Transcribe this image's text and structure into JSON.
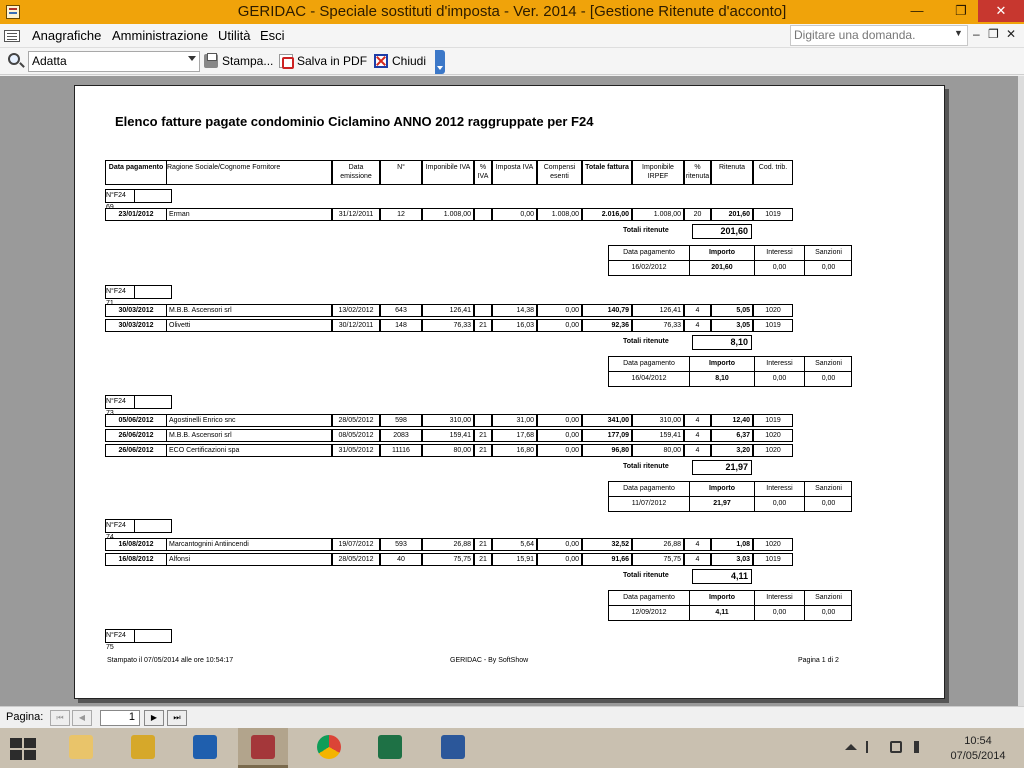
{
  "window": {
    "title": "GERIDAC - Speciale sostituti d'imposta - Ver. 2014 - [Gestione Ritenute d'acconto]",
    "minimize": "—",
    "restore": "❐",
    "close": "✕"
  },
  "menu": {
    "items": [
      "Anagrafiche",
      "Amministrazione",
      "Utilità",
      "Esci"
    ],
    "help_placeholder": "Digitare una domanda.",
    "mdi_min": "‒",
    "mdi_restore": "❐",
    "mdi_close": "✕"
  },
  "toolbar": {
    "zoom_value": "Adatta",
    "print_label": "Stampa...",
    "pdf_label": "Salva in PDF",
    "close_label": "Chiudi"
  },
  "report": {
    "title": "Elenco fatture pagate condominio Ciclamino ANNO 2012 raggruppate per F24",
    "headers": [
      "Data pagamento",
      "Ragione Sociale/Cognome Fornitore",
      "Data emissione",
      "N°",
      "Imponibile IVA",
      "% IVA",
      "Imposta IVA",
      "Compensi esenti",
      "Totale fattura",
      "Imponibile IRPEF",
      "% ritenuta",
      "Ritenuta",
      "Cod. trib."
    ],
    "f24_prefix": "N°F24",
    "totali_label": "Totali ritenute",
    "payment_headers": [
      "Data pagamento",
      "Importo",
      "Interessi",
      "Sanzioni"
    ],
    "groups": [
      {
        "f24": "69",
        "rows": [
          [
            "23/01/2012",
            "Erman",
            "31/12/2011",
            "12",
            "1.008,00",
            "",
            "0,00",
            "1.008,00",
            "2.016,00",
            "1.008,00",
            "20",
            "201,60",
            "1019"
          ]
        ],
        "total": "201,60",
        "payment": [
          "16/02/2012",
          "201,60",
          "0,00",
          "0,00"
        ]
      },
      {
        "f24": "71",
        "rows": [
          [
            "30/03/2012",
            "M.B.B. Ascensori srl",
            "13/02/2012",
            "643",
            "126,41",
            "",
            "14,38",
            "0,00",
            "140,79",
            "126,41",
            "4",
            "5,05",
            "1020"
          ],
          [
            "30/03/2012",
            "Olivetti",
            "30/12/2011",
            "148",
            "76,33",
            "21",
            "16,03",
            "0,00",
            "92,36",
            "76,33",
            "4",
            "3,05",
            "1019"
          ]
        ],
        "total": "8,10",
        "payment": [
          "16/04/2012",
          "8,10",
          "0,00",
          "0,00"
        ]
      },
      {
        "f24": "73",
        "rows": [
          [
            "05/06/2012",
            "Agostinelli Enrico snc",
            "28/05/2012",
            "598",
            "310,00",
            "",
            "31,00",
            "0,00",
            "341,00",
            "310,00",
            "4",
            "12,40",
            "1019"
          ],
          [
            "26/06/2012",
            "M.B.B. Ascensori srl",
            "08/05/2012",
            "2083",
            "159,41",
            "21",
            "17,68",
            "0,00",
            "177,09",
            "159,41",
            "4",
            "6,37",
            "1020"
          ],
          [
            "26/06/2012",
            "ECO Certificazioni spa",
            "31/05/2012",
            "11116",
            "80,00",
            "21",
            "16,80",
            "0,00",
            "96,80",
            "80,00",
            "4",
            "3,20",
            "1020"
          ]
        ],
        "total": "21,97",
        "payment": [
          "11/07/2012",
          "21,97",
          "0,00",
          "0,00"
        ]
      },
      {
        "f24": "74",
        "rows": [
          [
            "16/08/2012",
            "Marcantognini Antiincendi",
            "19/07/2012",
            "593",
            "26,88",
            "21",
            "5,64",
            "0,00",
            "32,52",
            "26,88",
            "4",
            "1,08",
            "1020"
          ],
          [
            "16/08/2012",
            "Alfonsi",
            "28/05/2012",
            "40",
            "75,75",
            "21",
            "15,91",
            "0,00",
            "91,66",
            "75,75",
            "4",
            "3,03",
            "1019"
          ]
        ],
        "total": "4,11",
        "payment": [
          "12/09/2012",
          "4,11",
          "0,00",
          "0,00"
        ]
      },
      {
        "f24": "75",
        "rows": [],
        "total": null,
        "payment": null
      }
    ],
    "footer": {
      "printed": "Stampato il 07/05/2014 alle ore 10:54:17",
      "brand": "GERIDAC  -  By SoftShow",
      "page": "Pagina 1 di 2"
    }
  },
  "status": {
    "pagina_label": "Pagina:",
    "page_number": "1",
    "nav": [
      "⏮",
      "◀",
      "▶",
      "⏭"
    ]
  },
  "taskbar": {
    "time": "10:54",
    "date": "07/05/2014",
    "apps": [
      "file-explorer",
      "tools",
      "outlook",
      "access",
      "chrome",
      "excel",
      "word"
    ]
  }
}
